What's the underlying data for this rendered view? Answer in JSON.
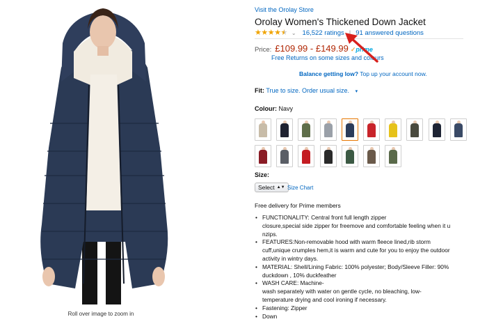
{
  "image": {
    "zoom_hint": "Roll over image to zoom in"
  },
  "store_link": "Visit the Orolay Store",
  "title": "Orolay Women's Thickened Down Jacket",
  "rating": {
    "stars": 4.5,
    "count_label": "16,522 ratings",
    "separator": "|",
    "questions_label": "91 answered questions"
  },
  "price": {
    "label": "Price:",
    "value": "£109.99 - £149.99",
    "prime_label": "prime"
  },
  "free_returns": "Free Returns on some sizes and colours",
  "balance": {
    "bold": "Balance getting low?",
    "link": "Top up your account now."
  },
  "fit": {
    "label": "Fit:",
    "value": "True to size. Order usual size."
  },
  "colour": {
    "label": "Colour:",
    "value": "Navy",
    "selected_index": 4,
    "swatches": [
      "#c8bca8",
      "#1f2230",
      "#5f6e4a",
      "#9aa0a8",
      "#2c3c5a",
      "#c8242a",
      "#e6c21a",
      "#4a4a3e",
      "#1e2434",
      "#3a4a66",
      "#8a1c26",
      "#5a5e66",
      "#c41c22",
      "#2a2a2a",
      "#3c5a44",
      "#6a5a4a",
      "#5a6a4a"
    ]
  },
  "size": {
    "label": "Size:",
    "select_value": "Select",
    "chart_link": "Size Chart"
  },
  "delivery": "Free delivery for Prime members",
  "features": [
    [
      "FUNCTIONALITY: Central front full length zipper",
      "closure,special side zipper for freemove and comfortable feeling when it u",
      "nzips."
    ],
    [
      "FEATURES:Non-removable hood with warm fleece lined,rib storm",
      "cuff,unique crumples hem,it is warm and cute for you to enjoy the outdoor",
      "activity in wintry days."
    ],
    [
      "MATERIAL: Shell/Lining Fabric: 100% polyester; Body/Sleeve Filler: 90%",
      "duckdown , 10% duckfeather"
    ],
    [
      "WASH CARE: Machine-",
      "wash separately with water on gentle cycle, no bleaching, low-",
      "temperature drying and cool ironing if necessary."
    ],
    [
      "Fastening: Zipper"
    ],
    [
      "Down"
    ]
  ],
  "colors": {
    "link": "#0066c0",
    "price": "#b12704",
    "star": "#f0a300",
    "arrow": "#d8211d",
    "selected_swatch": "#e77600"
  }
}
